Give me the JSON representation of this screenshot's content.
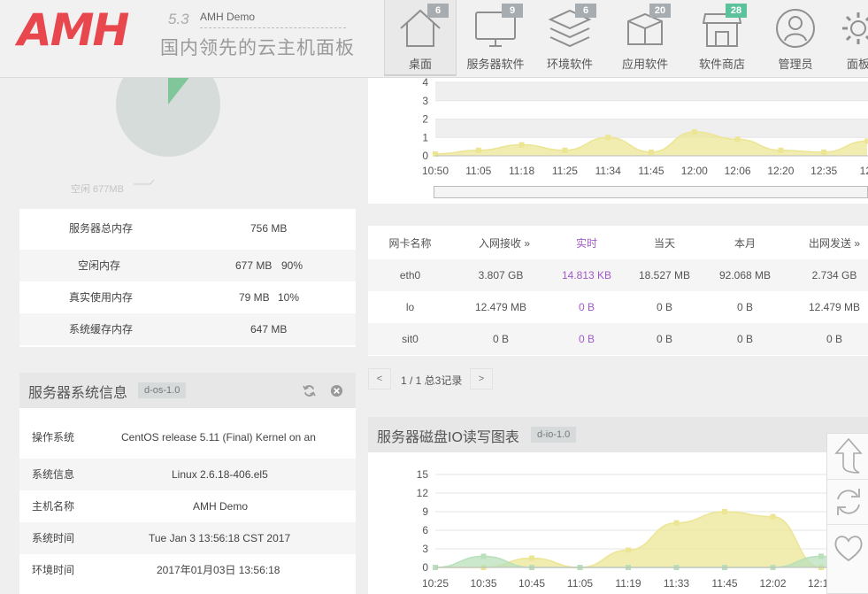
{
  "header": {
    "logo_text": "AMH",
    "version": "5.3",
    "demo": "AMH Demo",
    "slogan": "国内领先的云主机面板",
    "brand_color": "#e8474d",
    "nav": [
      {
        "label": "桌面",
        "badge": "6",
        "icon": "home-icon",
        "active": true
      },
      {
        "label": "服务器软件",
        "badge": "9",
        "icon": "monitor-icon"
      },
      {
        "label": "环境软件",
        "badge": "6",
        "icon": "layers-icon"
      },
      {
        "label": "应用软件",
        "badge": "20",
        "icon": "box-icon"
      },
      {
        "label": "软件商店",
        "badge": "28",
        "icon": "store-icon",
        "badge_color": "#5cc29b"
      },
      {
        "label": "管理员",
        "icon": "user-icon"
      },
      {
        "label": "面板",
        "icon": "gear-icon"
      }
    ]
  },
  "memory": {
    "pie_label": "空闲 677MB",
    "rows": [
      {
        "label": "服务器总内存",
        "value": "756 MB",
        "percent": ""
      },
      {
        "label": "空闲内存",
        "value": "677 MB",
        "percent": "90%"
      },
      {
        "label": "真实使用内存",
        "value": "79 MB",
        "percent": "10%"
      },
      {
        "label": "系统缓存内存",
        "value": "647 MB",
        "percent": ""
      }
    ]
  },
  "sysinfo": {
    "title": "服务器系统信息",
    "tag": "d-os-1.0",
    "rows": [
      {
        "label": "操作系统",
        "value": "CentOS release 5.11 (Final) Kernel on an"
      },
      {
        "label": "系统信息",
        "value": "Linux 2.6.18-406.el5"
      },
      {
        "label": "主机名称",
        "value": "AMH Demo"
      },
      {
        "label": "系统时间",
        "value": "Tue Jan 3 13:56:18 CST 2017"
      },
      {
        "label": "环境时间",
        "value": "2017年01月03日 13:56:18"
      }
    ]
  },
  "network": {
    "headers": [
      "网卡名称",
      "入网接收 »",
      "实时",
      "当天",
      "本月",
      "出网发送 »"
    ],
    "rows": [
      [
        "eth0",
        "3.807 GB",
        "14.813 KB",
        "18.527 MB",
        "92.068 MB",
        "2.734 GB"
      ],
      [
        "lo",
        "12.479 MB",
        "0 B",
        "0 B",
        "0 B",
        "12.479 MB"
      ],
      [
        "sit0",
        "0 B",
        "0 B",
        "0 B",
        "0 B",
        "0 B"
      ]
    ],
    "pager": {
      "prev": "<",
      "info": "1 / 1 总3记录",
      "next": ">"
    }
  },
  "cpu_chart": {
    "y_ticks": [
      "0",
      "1",
      "2",
      "3",
      "4"
    ],
    "x_ticks": [
      "10:50",
      "11:05",
      "11:18",
      "11:25",
      "11:34",
      "11:45",
      "12:00",
      "12:06",
      "12:20",
      "12:35",
      "12:"
    ]
  },
  "disk_io": {
    "title": "服务器磁盘IO读写图表",
    "tag": "d-io-1.0",
    "y_ticks": [
      "0",
      "3",
      "6",
      "9",
      "12",
      "15"
    ],
    "x_ticks": [
      "10:25",
      "10:35",
      "10:45",
      "11:05",
      "11:19",
      "11:33",
      "11:45",
      "12:02",
      "12:15",
      "12:"
    ]
  },
  "chart_data": [
    {
      "type": "area",
      "ylim": [
        0,
        4
      ],
      "x": [
        "10:50",
        "11:05",
        "11:18",
        "11:25",
        "11:34",
        "11:45",
        "12:00",
        "12:06",
        "12:20",
        "12:35",
        "12:"
      ],
      "series": [
        {
          "values": [
            0.1,
            0.3,
            0.6,
            0.3,
            1.0,
            0.2,
            1.3,
            0.9,
            0.3,
            0.2,
            0.8
          ],
          "color": "#ece594"
        }
      ]
    },
    {
      "type": "area",
      "ylim": [
        0,
        15
      ],
      "x": [
        "10:25",
        "10:35",
        "10:45",
        "11:05",
        "11:19",
        "11:33",
        "11:45",
        "12:02",
        "12:15",
        "12:"
      ],
      "series": [
        {
          "values": [
            0,
            0,
            1.5,
            0,
            2.8,
            7.2,
            9.0,
            8.2,
            0,
            0
          ],
          "color": "#ece594"
        },
        {
          "values": [
            0,
            1.8,
            0,
            0,
            0,
            0,
            0,
            0,
            1.8,
            0
          ],
          "color": "#b9e0bb"
        }
      ]
    }
  ]
}
